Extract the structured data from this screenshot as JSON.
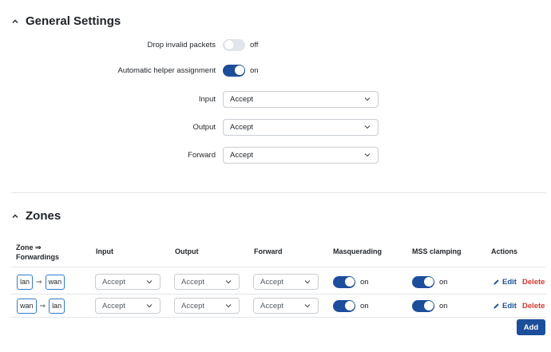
{
  "general": {
    "title": "General Settings",
    "drop_invalid": {
      "label": "Drop invalid packets",
      "state": "off"
    },
    "auto_helper": {
      "label": "Automatic helper assignment",
      "state": "on"
    },
    "input": {
      "label": "Input",
      "value": "Accept"
    },
    "output": {
      "label": "Output",
      "value": "Accept"
    },
    "forward": {
      "label": "Forward",
      "value": "Accept"
    }
  },
  "zones": {
    "title": "Zones",
    "columns": [
      "Zone ⇒ Forwardings",
      "Input",
      "Output",
      "Forward",
      "Masquerading",
      "MSS clamping",
      "Actions"
    ],
    "rows": [
      {
        "from": "lan",
        "arrow": "⇒",
        "to": "wan",
        "input": "Accept",
        "output": "Accept",
        "forward": "Accept",
        "masquerading": "on",
        "mss_clamping": "on",
        "edit": "Edit",
        "delete": "Delete"
      },
      {
        "from": "wan",
        "arrow": "⇒",
        "to": "lan",
        "input": "Accept",
        "output": "Accept",
        "forward": "Accept",
        "masquerading": "on",
        "mss_clamping": "on",
        "edit": "Edit",
        "delete": "Delete"
      }
    ],
    "add_label": "Add"
  }
}
